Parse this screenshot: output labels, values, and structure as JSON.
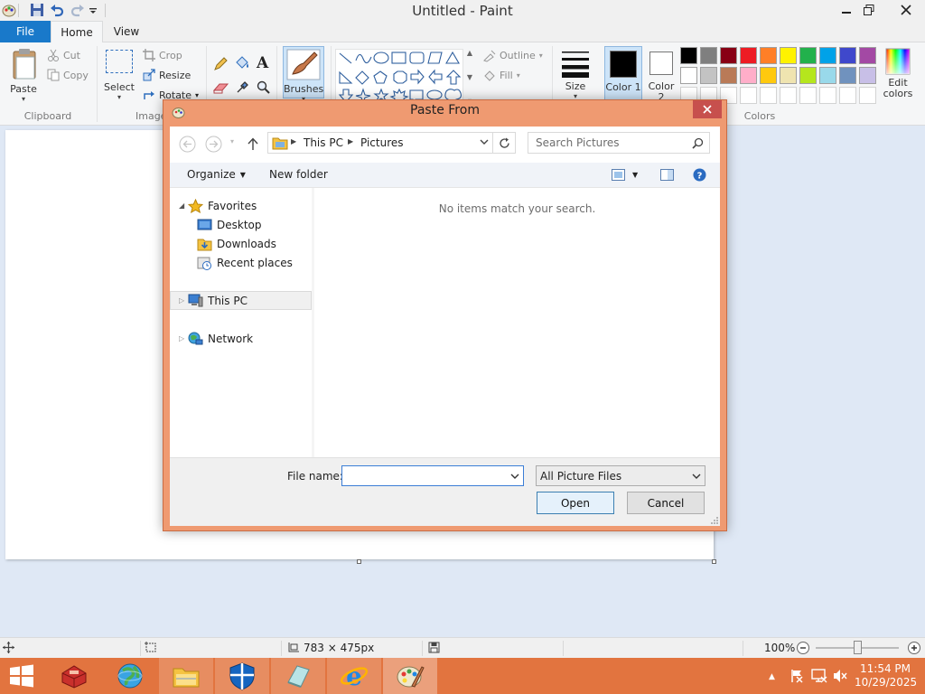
{
  "window": {
    "title": "Untitled - Paint"
  },
  "ribbon_tabs": {
    "file": "File",
    "home": "Home",
    "view": "View"
  },
  "clipboard": {
    "paste": "Paste",
    "cut": "Cut",
    "copy": "Copy",
    "group": "Clipboard"
  },
  "image": {
    "select": "Select",
    "crop": "Crop",
    "resize": "Resize",
    "rotate": "Rotate",
    "group": "Image"
  },
  "tools": {
    "brushes": "Brushes"
  },
  "shapes": {
    "outline": "Outline",
    "fill": "Fill"
  },
  "size": {
    "label": "Size"
  },
  "color1": {
    "label": "Color 1",
    "value": "#000000"
  },
  "color2": {
    "label": "Color 2",
    "value": "#ffffff"
  },
  "colors": {
    "group": "Colors",
    "edit": "Edit colors",
    "row1": [
      "#000000",
      "#7f7f7f",
      "#880015",
      "#ed1c24",
      "#ff7f27",
      "#fff200",
      "#22b14c",
      "#00a2e8",
      "#3f48cc",
      "#a349a4"
    ],
    "row2": [
      "#ffffff",
      "#c3c3c3",
      "#b97a57",
      "#ffaec9",
      "#ffc90e",
      "#efe4b0",
      "#b5e61d",
      "#99d9ea",
      "#7092be",
      "#c8bfe7"
    ]
  },
  "statusbar": {
    "dimensions": "783 × 475px",
    "zoom": "100%"
  },
  "dialog": {
    "title": "Paste From",
    "address": {
      "segment1": "This PC",
      "segment2": "Pictures"
    },
    "search_placeholder": "Search Pictures",
    "organize": "Organize",
    "new_folder": "New folder",
    "nav": {
      "favorites": "Favorites",
      "desktop": "Desktop",
      "downloads": "Downloads",
      "recent": "Recent places",
      "this_pc": "This PC",
      "network": "Network"
    },
    "empty_message": "No items match your search.",
    "file_name_label": "File name:",
    "file_name_value": "",
    "file_type": "All Picture Files",
    "open": "Open",
    "cancel": "Cancel"
  },
  "taskbar": {
    "time": "11:54 PM",
    "date": "10/29/2025"
  }
}
